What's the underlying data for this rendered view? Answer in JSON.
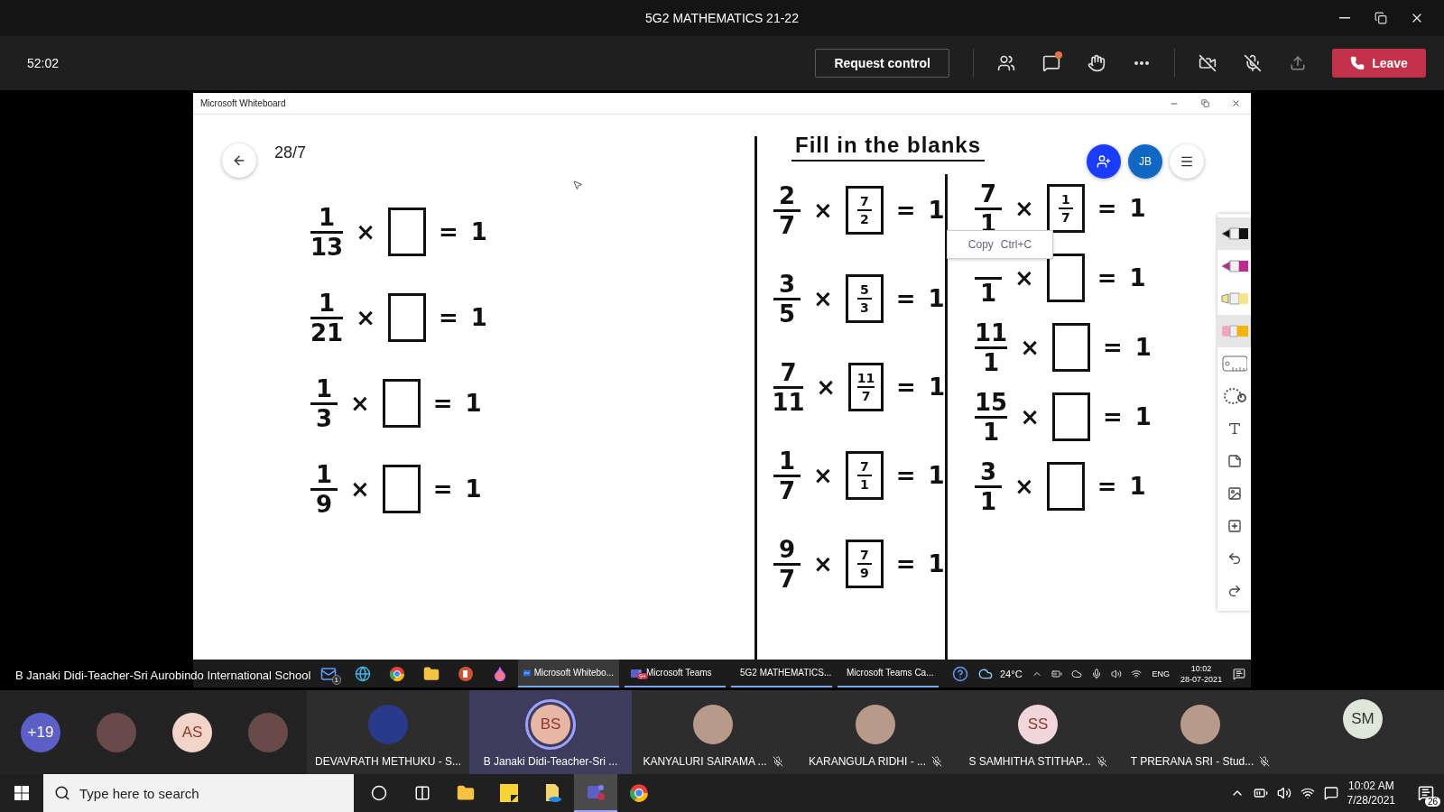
{
  "window": {
    "title": "5G2 MATHEMATICS 21-22"
  },
  "meeting_bar": {
    "timer": "52:02",
    "request_control": "Request control",
    "chat_unread": true,
    "leave": "Leave"
  },
  "whiteboard": {
    "title": "Microsoft Whiteboard",
    "date": "28/7",
    "heading": "Fill in the blanks",
    "user_initials": "JB",
    "columns": [
      {
        "equations": [
          {
            "numerator": "1",
            "denominator": "13",
            "operator": "×",
            "equals": "=",
            "result": "1"
          },
          {
            "numerator": "1",
            "denominator": "21",
            "operator": "×",
            "equals": "=",
            "result": "1"
          },
          {
            "numerator": "1",
            "denominator": "3",
            "operator": "×",
            "equals": "=",
            "result": "1"
          },
          {
            "numerator": "1",
            "denominator": "9",
            "operator": "×",
            "equals": "=",
            "result": "1"
          }
        ]
      },
      {
        "equations": [
          {
            "numerator": "2",
            "denominator": "7",
            "operator": "×",
            "answer": {
              "numerator": "7",
              "denominator": "2"
            },
            "equals": "=",
            "result": "1"
          },
          {
            "numerator": "3",
            "denominator": "5",
            "operator": "×",
            "answer": {
              "numerator": "5",
              "denominator": "3"
            },
            "equals": "=",
            "result": "1"
          },
          {
            "numerator": "7",
            "denominator": "11",
            "operator": "×",
            "answer": {
              "numerator": "11",
              "denominator": "7"
            },
            "equals": "=",
            "result": "1"
          },
          {
            "numerator": "1",
            "denominator": "7",
            "operator": "×",
            "answer": {
              "numerator": "7",
              "denominator": "1"
            },
            "equals": "=",
            "result": "1"
          },
          {
            "numerator": "9",
            "denominator": "7",
            "operator": "×",
            "answer": {
              "numerator": "7",
              "denominator": "9"
            },
            "equals": "=",
            "result": "1"
          }
        ]
      },
      {
        "equations": [
          {
            "numerator": "7",
            "denominator": "1",
            "operator": "×",
            "answer": {
              "numerator": "1",
              "denominator": "7"
            },
            "equals": "=",
            "result": "1"
          },
          {
            "denominator": "1",
            "operator": "×",
            "equals": "=",
            "result": "1"
          },
          {
            "numerator": "11",
            "denominator": "1",
            "operator": "×",
            "equals": "=",
            "result": "1"
          },
          {
            "numerator": "15",
            "denominator": "1",
            "operator": "×",
            "equals": "=",
            "result": "1"
          },
          {
            "numerator": "3",
            "denominator": "1",
            "operator": "×",
            "equals": "=",
            "result": "1"
          }
        ]
      }
    ],
    "tools": [
      {
        "kind": "pen",
        "color": "#111111",
        "selected": true
      },
      {
        "kind": "pen",
        "color": "#c2268f",
        "selected": false
      },
      {
        "kind": "highlighter",
        "color": "#f7e58a",
        "selected": false
      },
      {
        "kind": "eraser",
        "selected": true
      },
      {
        "kind": "ruler",
        "selected": false
      },
      {
        "kind": "lasso",
        "selected": false
      },
      {
        "kind": "text",
        "selected": false
      },
      {
        "kind": "note",
        "selected": false
      },
      {
        "kind": "image",
        "selected": false
      },
      {
        "kind": "add",
        "selected": false
      },
      {
        "kind": "undo",
        "selected": false
      },
      {
        "kind": "redo",
        "selected": false
      }
    ],
    "context_menu": {
      "label": "Copy",
      "shortcut": "Ctrl+C"
    }
  },
  "presenter_label": "B Janaki Didi-Teacher-Sri Aurobindo International School",
  "inner_taskbar": {
    "pinned": [
      {
        "kind": "mail",
        "badge": "1"
      },
      {
        "kind": "edge"
      },
      {
        "kind": "chrome"
      },
      {
        "kind": "folder"
      },
      {
        "kind": "powerpoint"
      },
      {
        "kind": "drop"
      }
    ],
    "apps": [
      {
        "label": "Microsoft Whitebo...",
        "kind": "whiteboard",
        "selected": true
      },
      {
        "label": "Microsoft Teams",
        "kind": "teams",
        "badge": "9+",
        "selected": false
      },
      {
        "label": "5G2 MATHEMATICS...",
        "kind": "teams",
        "selected": false
      },
      {
        "label": "Microsoft Teams Ca...",
        "kind": "teams",
        "selected": false
      }
    ],
    "weather": "24°C",
    "language": "ENG",
    "time": "10:02",
    "date": "28-07-2021"
  },
  "participants": {
    "overflow": "+19",
    "avatars": [
      {
        "kind": "photo"
      },
      {
        "kind": "initials",
        "initials": "AS"
      },
      {
        "kind": "photo"
      }
    ],
    "tiles": [
      {
        "name": "DEVAVRATH METHUKU - S...",
        "kind": "photo",
        "speaking": false,
        "muted": false
      },
      {
        "name": "B Janaki Didi-Teacher-Sri ...",
        "kind": "initials",
        "initials": "BS",
        "speaking": true,
        "muted": false
      },
      {
        "name": "KANYALURI SAIRAMA ...",
        "kind": "photo",
        "speaking": false,
        "muted": true
      },
      {
        "name": "KARANGULA RIDHI - ...",
        "kind": "photo",
        "speaking": false,
        "muted": true
      },
      {
        "name": "S SAMHITHA STITHAP...",
        "kind": "initials",
        "initials": "SS",
        "speaking": false,
        "muted": true
      },
      {
        "name": "T PRERANA SRI - Stud...",
        "kind": "photo",
        "speaking": false,
        "muted": true
      }
    ],
    "end_avatar": {
      "initials": "SM"
    }
  },
  "taskbar": {
    "search_placeholder": "Type here to search",
    "apps": [
      {
        "kind": "cortana",
        "selected": false
      },
      {
        "kind": "task-view",
        "selected": false
      },
      {
        "kind": "explorer",
        "selected": false
      },
      {
        "kind": "sticky-notes",
        "selected": false
      },
      {
        "kind": "onedrive",
        "selected": false
      },
      {
        "kind": "teams",
        "selected": true
      },
      {
        "kind": "chrome",
        "selected": false
      }
    ],
    "time": "10:02 AM",
    "date": "7/28/2021",
    "notifications": "26"
  }
}
